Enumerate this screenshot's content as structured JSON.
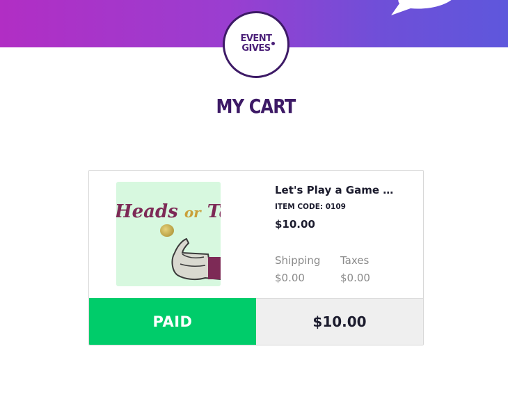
{
  "header": {
    "logo_text": "EVENT\nGIVES"
  },
  "page": {
    "title": "MY CART"
  },
  "cart_item": {
    "image_text_1": "Heads",
    "image_text_2": "or",
    "image_text_3": "Tails",
    "title": "Let's Play a Game o...",
    "item_code": "ITEM CODE: 0109",
    "price": "$10.00",
    "shipping_label": "Shipping",
    "shipping_value": "$0.00",
    "taxes_label": "Taxes",
    "taxes_value": "$0.00"
  },
  "footer": {
    "status": "PAID",
    "total": "$10.00"
  },
  "colors": {
    "brand_purple": "#3d1a66",
    "paid_green": "#00cc6a",
    "banner_start": "#b12ec4",
    "banner_end": "#5e57dc"
  }
}
